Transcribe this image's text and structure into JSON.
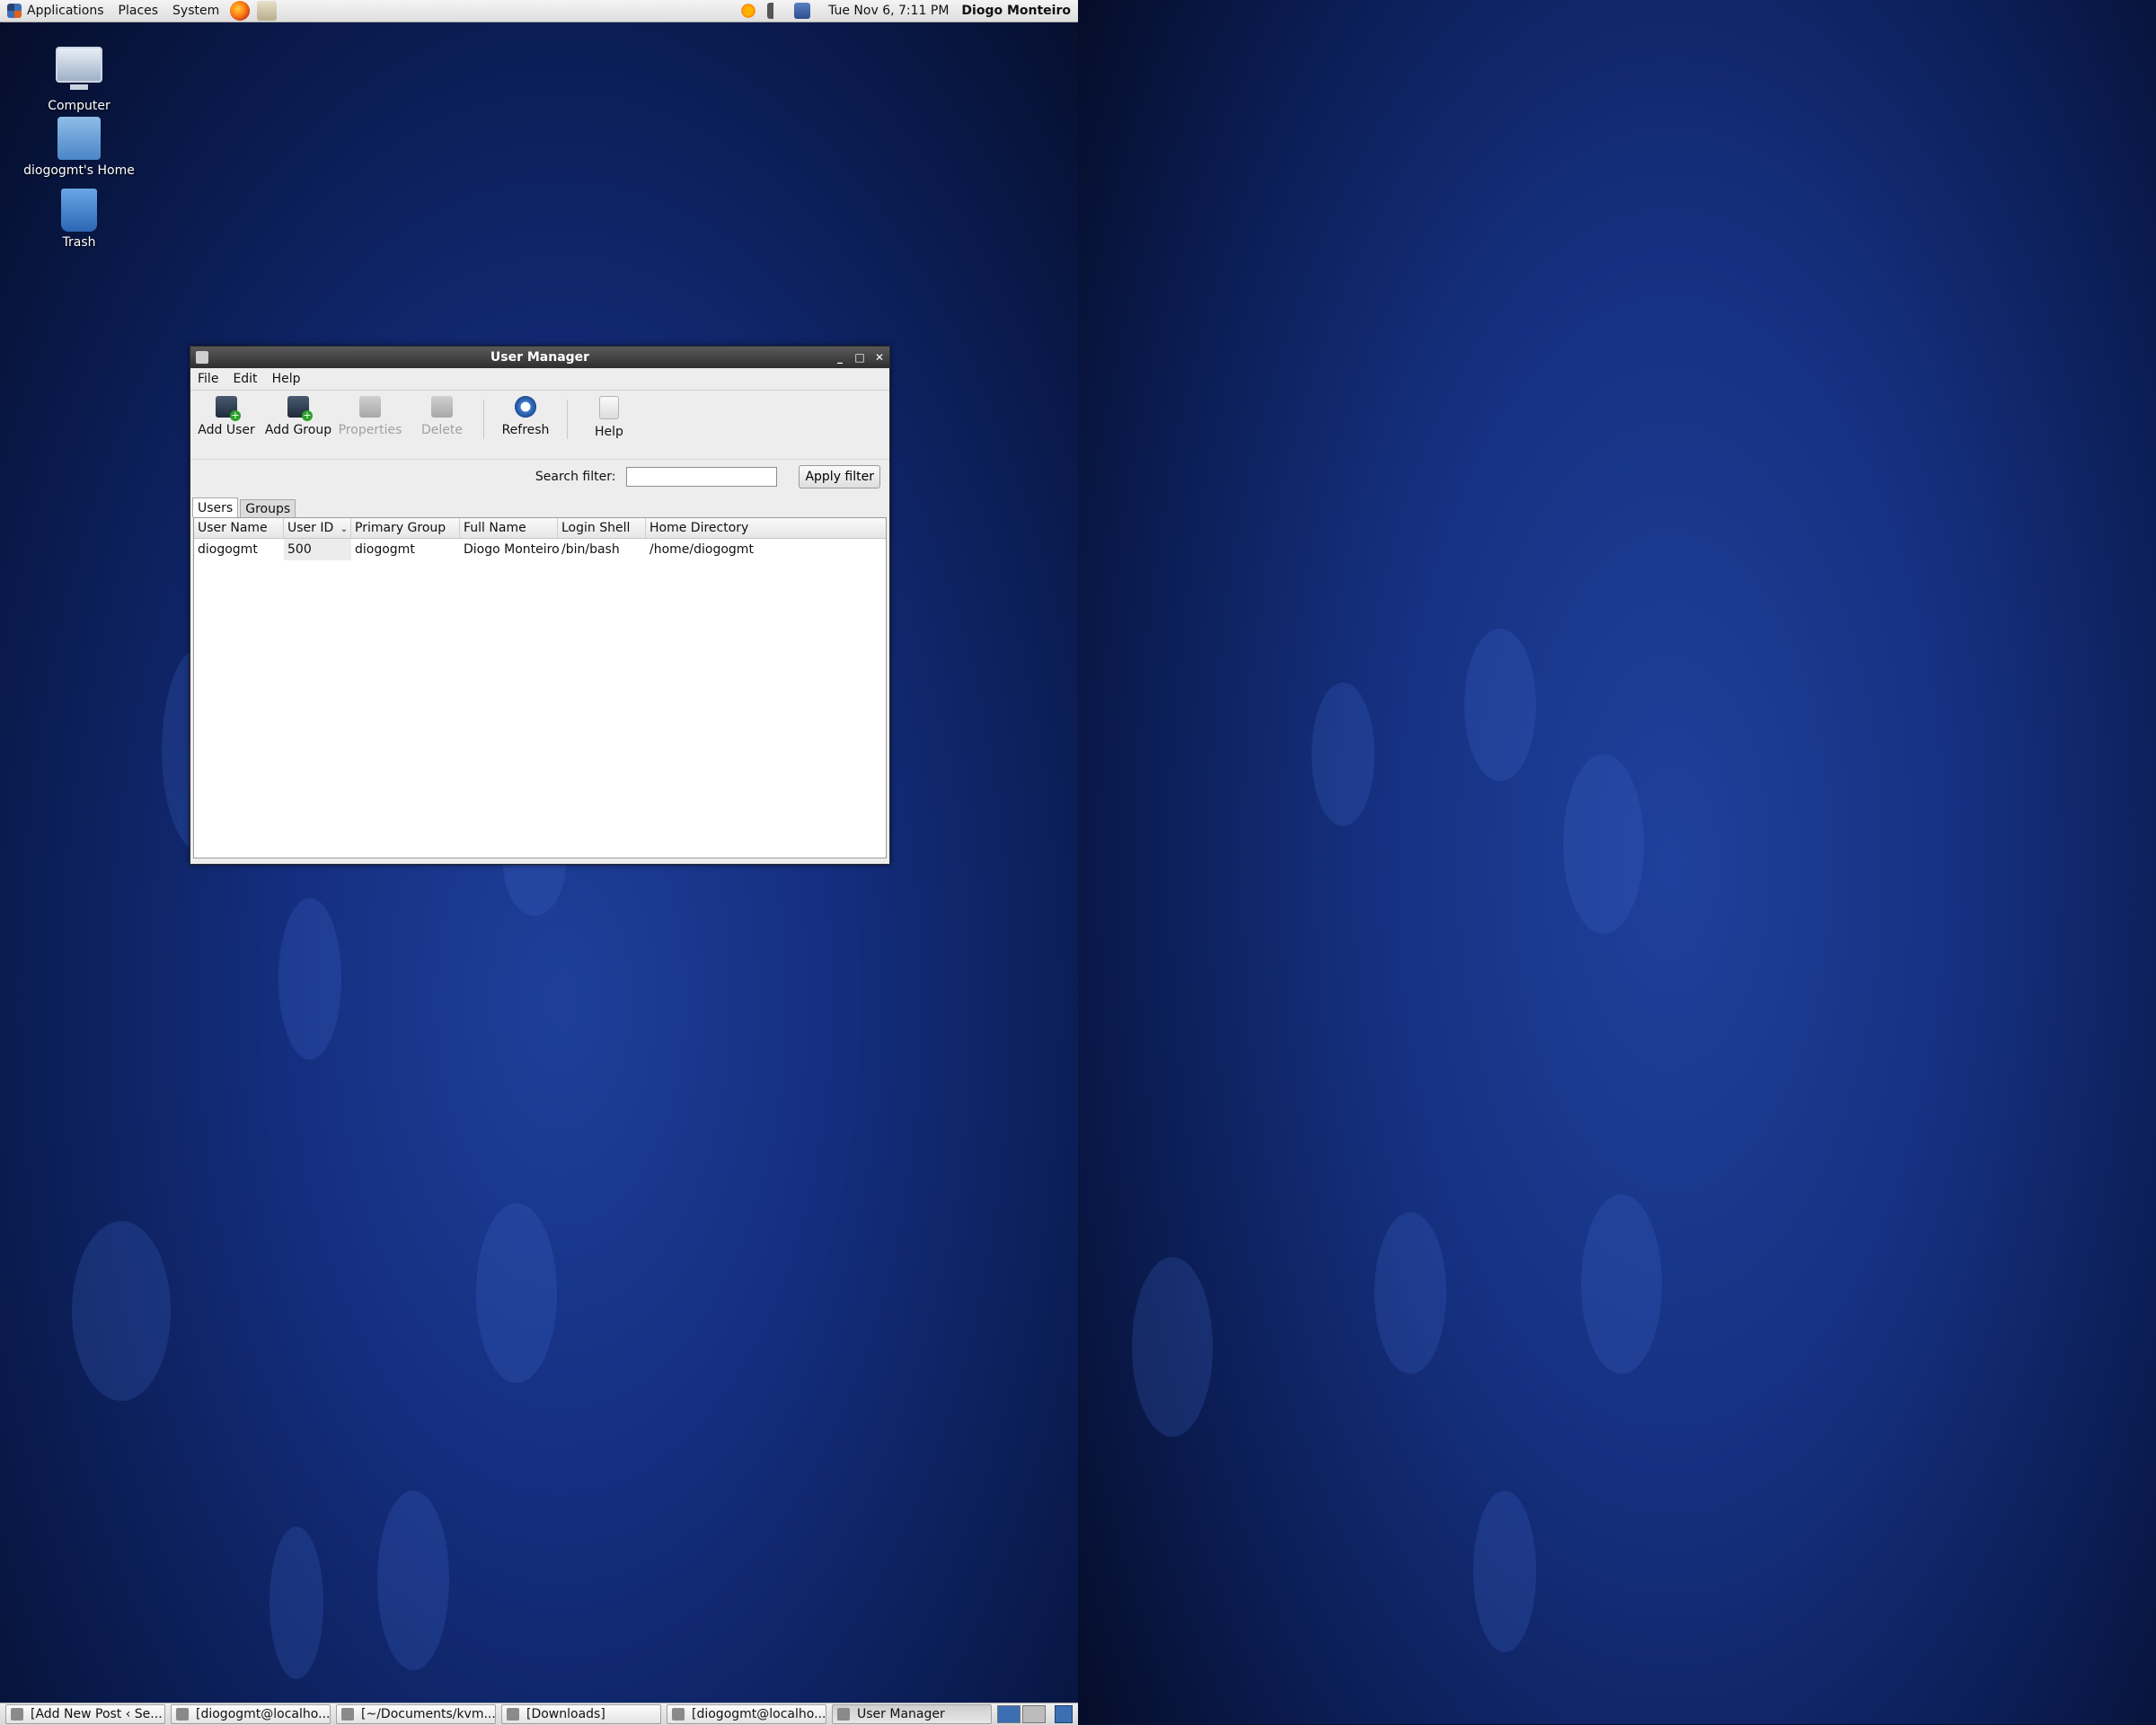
{
  "top_panel": {
    "applications": "Applications",
    "places": "Places",
    "system": "System",
    "clock": "Tue Nov  6,  7:11 PM",
    "user": "Diogo Monteiro"
  },
  "desktop_icons": {
    "computer": "Computer",
    "home": "diogogmt's Home",
    "trash": "Trash"
  },
  "window": {
    "title": "User Manager",
    "menus": {
      "file": "File",
      "edit": "Edit",
      "help": "Help"
    },
    "toolbar": {
      "add_user": "Add User",
      "add_group": "Add Group",
      "properties": "Properties",
      "delete": "Delete",
      "refresh": "Refresh",
      "help": "Help"
    },
    "search_label": "Search filter:",
    "search_value": "",
    "apply_filter": "Apply filter",
    "tabs": {
      "users": "Users",
      "groups": "Groups"
    },
    "columns": {
      "user_name": "User Name",
      "user_id": "User ID",
      "primary_group": "Primary Group",
      "full_name": "Full Name",
      "login_shell": "Login Shell",
      "home_directory": "Home Directory"
    },
    "rows": [
      {
        "user_name": "diogogmt",
        "user_id": "500",
        "primary_group": "diogogmt",
        "full_name": "Diogo Monteiro",
        "login_shell": "/bin/bash",
        "home_directory": "/home/diogogmt"
      }
    ]
  },
  "taskbar": {
    "tasks": [
      "[Add New Post ‹ Se...",
      "[diogogmt@localho...",
      "[~/Documents/kvm...",
      "[Downloads]",
      "[diogogmt@localho...",
      "User Manager"
    ]
  }
}
